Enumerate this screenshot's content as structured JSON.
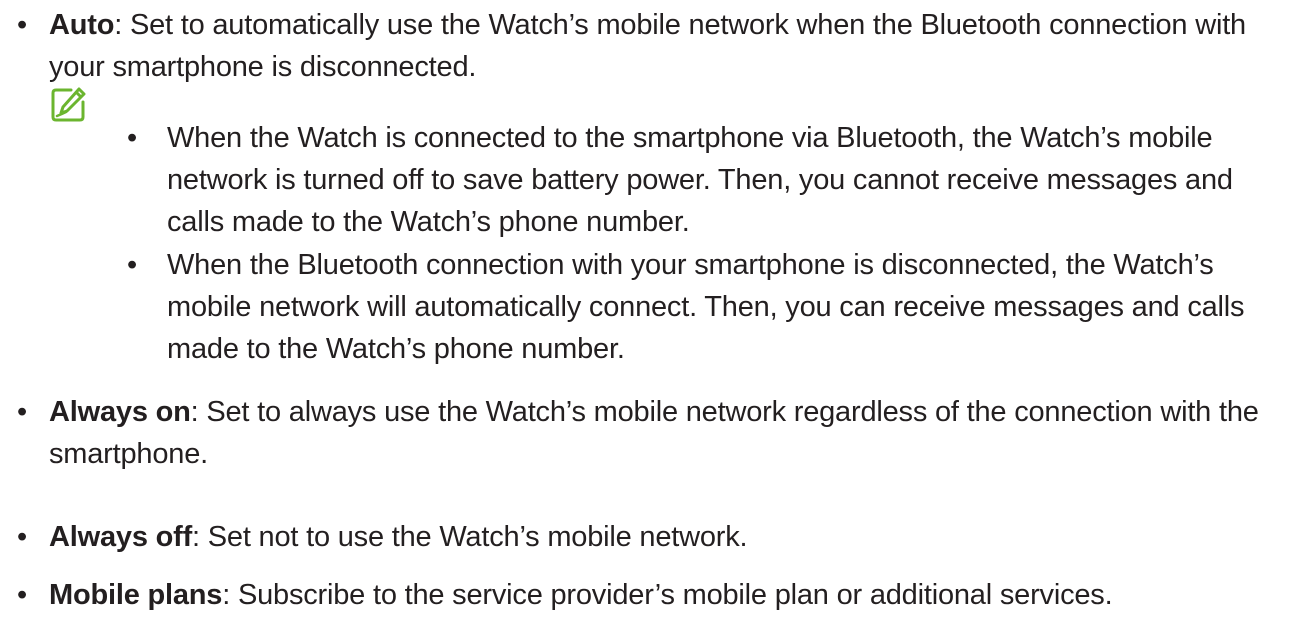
{
  "bullet_char": "•",
  "items": [
    {
      "term": "Auto",
      "text": ": Set to automatically use the Watch’s mobile network when the Bluetooth connection with your smartphone is disconnected."
    },
    {
      "term": "Always on",
      "text": ": Set to always use the Watch’s mobile network regardless of the connection with the smartphone."
    },
    {
      "term": "Always off",
      "text": ": Set not to use the Watch’s mobile network."
    },
    {
      "term": "Mobile plans",
      "text": ": Subscribe to the service provider’s mobile plan or additional services."
    }
  ],
  "note": {
    "icon": "note-pencil-icon",
    "icon_color": "#6bb52f",
    "items": [
      "When the Watch is connected to the smartphone via Bluetooth, the Watch’s mobile network is turned off to save battery power. Then, you cannot receive messages and calls made to the Watch’s phone number.",
      "When the Bluetooth connection with your smartphone is disconnected, the Watch’s mobile network will automatically connect. Then, you can receive messages and calls made to the Watch’s phone number."
    ]
  }
}
